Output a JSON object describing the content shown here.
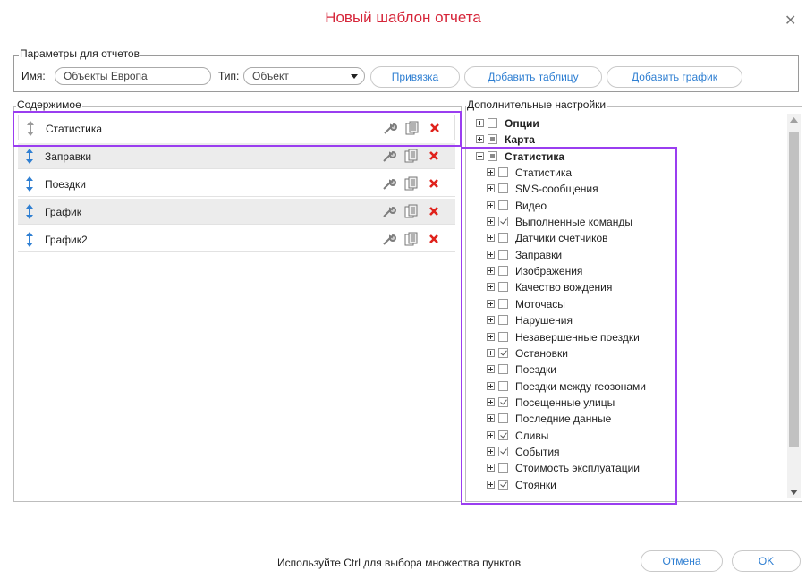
{
  "dialog": {
    "title": "Новый шаблон отчета"
  },
  "params": {
    "legend": "Параметры для отчетов",
    "name_label": "Имя:",
    "name_value": "Объекты Европа",
    "type_label": "Тип:",
    "type_value": "Объект",
    "binding_button": "Привязка",
    "add_table_button": "Добавить таблицу",
    "add_chart_button": "Добавить график"
  },
  "content": {
    "legend": "Содержимое",
    "items": [
      {
        "label": "Статистика"
      },
      {
        "label": "Заправки"
      },
      {
        "label": "Поездки"
      },
      {
        "label": "График"
      },
      {
        "label": "График2"
      }
    ]
  },
  "advanced": {
    "legend": "Дополнительные настройки",
    "top": [
      {
        "label": "Опции",
        "expander": "plus",
        "check": "none"
      },
      {
        "label": "Карта",
        "expander": "plus",
        "check": "partial"
      },
      {
        "label": "Статистика",
        "expander": "minus",
        "check": "partial"
      }
    ],
    "children": [
      {
        "label": "Статистика",
        "checked": false
      },
      {
        "label": "SMS-сообщения",
        "checked": false
      },
      {
        "label": "Видео",
        "checked": false
      },
      {
        "label": "Выполненные команды",
        "checked": true
      },
      {
        "label": "Датчики счетчиков",
        "checked": false
      },
      {
        "label": "Заправки",
        "checked": false
      },
      {
        "label": "Изображения",
        "checked": false
      },
      {
        "label": "Качество вождения",
        "checked": false
      },
      {
        "label": "Моточасы",
        "checked": false
      },
      {
        "label": "Нарушения",
        "checked": false
      },
      {
        "label": "Незавершенные поездки",
        "checked": false
      },
      {
        "label": "Остановки",
        "checked": true
      },
      {
        "label": "Поездки",
        "checked": false
      },
      {
        "label": "Поездки между геозонами",
        "checked": false
      },
      {
        "label": "Посещенные улицы",
        "checked": true
      },
      {
        "label": "Последние данные",
        "checked": false
      },
      {
        "label": "Сливы",
        "checked": true
      },
      {
        "label": "События",
        "checked": true
      },
      {
        "label": "Стоимость эксплуатации",
        "checked": false
      },
      {
        "label": "Стоянки",
        "checked": true
      }
    ]
  },
  "footer": {
    "hint": "Используйте Ctrl для выбора множества пунктов",
    "cancel_button": "Отмена",
    "ok_button": "OK"
  },
  "colors": {
    "title": "#d6263a",
    "link": "#2f7fd2",
    "highlight": "#9a3df0",
    "delete": "#e0211b",
    "grip": "#2f7fd2"
  }
}
